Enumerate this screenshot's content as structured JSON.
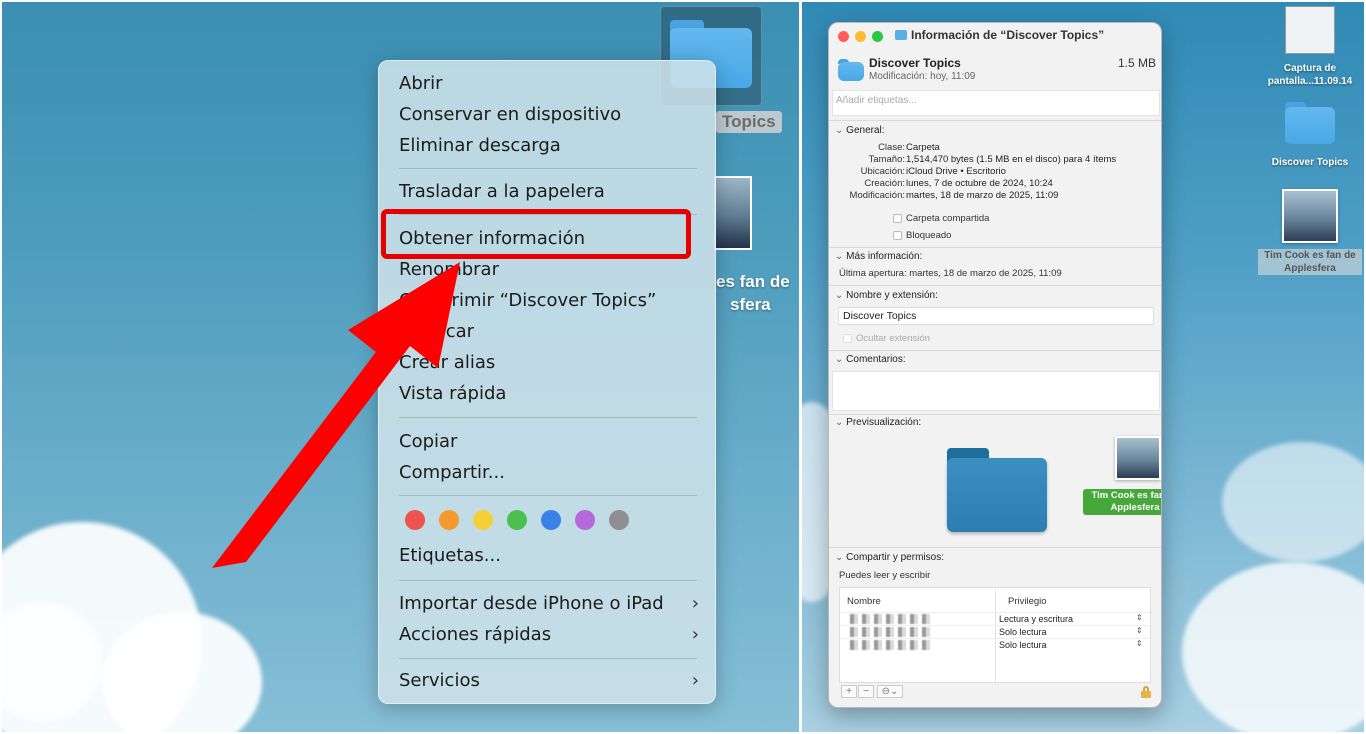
{
  "left": {
    "desktop": {
      "folder_label_partial": "Topics",
      "photo_label_partial_line1": "es fan de",
      "photo_label_partial_line2": "sfera"
    },
    "context_menu": {
      "items": [
        "Abrir",
        "Conservar en dispositivo",
        "Eliminar descarga",
        "Trasladar a la papelera",
        "Obtener información",
        "Renombrar",
        "Comprimir “Discover Topics”",
        "Duplicar",
        "Crear alias",
        "Vista rápida",
        "Copiar",
        "Compartir...",
        "Etiquetas...",
        "Importar desde iPhone o iPad",
        "Acciones rápidas",
        "Servicios"
      ],
      "tag_colors": [
        "#ef5350",
        "#f59a2e",
        "#f5cf3a",
        "#4cbf50",
        "#3b82e6",
        "#b46ad9",
        "#8e8e93"
      ],
      "highlighted_item": "Obtener información",
      "highlight_color": "#e60000"
    }
  },
  "right": {
    "desktop": {
      "screenshot_label_line1": "Captura de",
      "screenshot_label_line2": "pantalla...11.09.14",
      "folder_label": "Discover Topics",
      "photo_label_line1": "Tim Cook es fan de",
      "photo_label_line2": "Applesfera"
    },
    "info_window": {
      "title": "Información de “Discover Topics”",
      "name": "Discover Topics",
      "size": "1.5 MB",
      "modified": "Modificación: hoy, 11:09",
      "tags_placeholder": "Añadir etiquetas...",
      "general": {
        "header": "General:",
        "rows": [
          {
            "key": "Clase:",
            "value": "Carpeta"
          },
          {
            "key": "Tamaño:",
            "value": "1,514,470 bytes (1.5 MB en el disco) para 4 ítems"
          },
          {
            "key": "Ubicación:",
            "value": "iCloud Drive • Escritorio"
          },
          {
            "key": "Creación:",
            "value": "lunes, 7 de octubre de 2024, 10:24"
          },
          {
            "key": "Modificación:",
            "value": "martes, 18 de marzo de 2025, 11:09"
          }
        ],
        "shared_folder": "Carpeta compartida",
        "locked": "Bloqueado"
      },
      "more_info": {
        "header": "Más información:",
        "last_opened": "Última apertura: martes, 18 de marzo de 2025, 11:09"
      },
      "name_ext": {
        "header": "Nombre y extensión:",
        "value": "Discover Topics",
        "hide_extension": "Ocultar extensión"
      },
      "comments": {
        "header": "Comentarios:"
      },
      "preview": {
        "header": "Previsualización:",
        "drag_label_line1": "Tim Cook es fan de",
        "drag_label_line2": "Applesfera"
      },
      "sharing": {
        "header": "Compartir y permisos:",
        "subtitle": "Puedes leer y escribir",
        "col_name": "Nombre",
        "col_privilege": "Privilegio",
        "rows": [
          "Lectura y escritura",
          "Solo lectura",
          "Solo lectura"
        ],
        "add_btn": "+",
        "remove_btn": "−",
        "action_btn": "⊖⌄"
      }
    }
  }
}
